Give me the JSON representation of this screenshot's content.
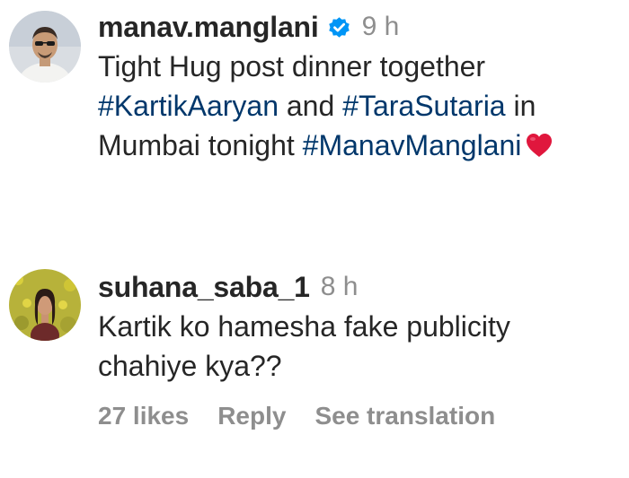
{
  "comments": [
    {
      "username": "manav.manglani",
      "verified": true,
      "time": "9 h",
      "text_parts": [
        "Tight Hug post dinner together ",
        "#KartikAaryan",
        " and ",
        "#TaraSutaria",
        " in Mumbai tonight ",
        "#ManavManglani"
      ],
      "trailing_icon": "red-heart-emoji",
      "hashtag_color": "#00376b"
    },
    {
      "username": "suhana_saba_1",
      "verified": false,
      "time": "8 h",
      "text": "Kartik ko hamesha fake publicity chahiye kya??",
      "actions": {
        "likes": "27 likes",
        "reply": "Reply",
        "translate": "See translation"
      }
    }
  ],
  "colors": {
    "text": "#262626",
    "muted": "#8e8e8e",
    "verified_badge": "#0095f6",
    "heart": "#e0173d"
  }
}
